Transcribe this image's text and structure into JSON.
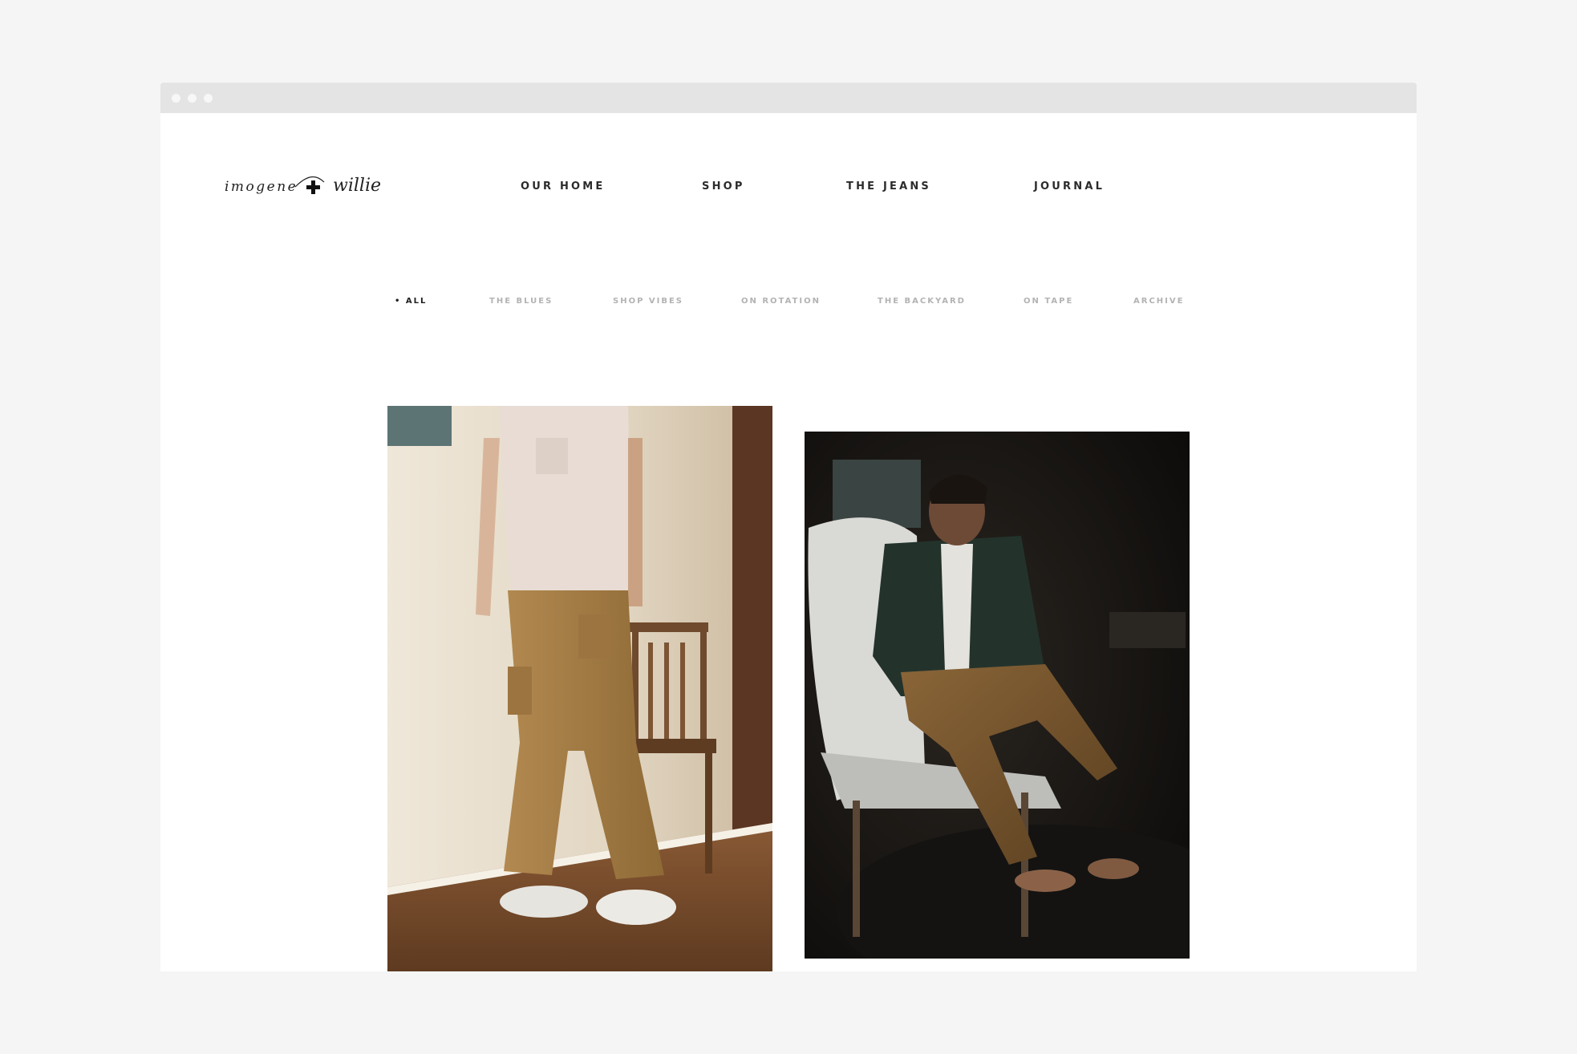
{
  "logo": {
    "left": "imogene",
    "right": "willie",
    "aria": "imogene + willie"
  },
  "nav": {
    "items": [
      {
        "label": "OUR HOME"
      },
      {
        "label": "SHOP"
      },
      {
        "label": "THE JEANS"
      },
      {
        "label": "JOURNAL"
      }
    ]
  },
  "filters": {
    "active_bullet": "•",
    "items": [
      {
        "label": "ALL",
        "active": true
      },
      {
        "label": "THE BLUES"
      },
      {
        "label": "SHOP VIBES"
      },
      {
        "label": "ON ROTATION"
      },
      {
        "label": "THE BACKYARD"
      },
      {
        "label": "ON TAPE"
      },
      {
        "label": "ARCHIVE"
      }
    ]
  },
  "colors": {
    "page_bg": "#f4f5f4",
    "titlebar": "#e4e4e4",
    "nav_text": "#2b2b2b",
    "filter_inactive": "#b3b3b3",
    "filter_active": "#1e1e1e"
  }
}
